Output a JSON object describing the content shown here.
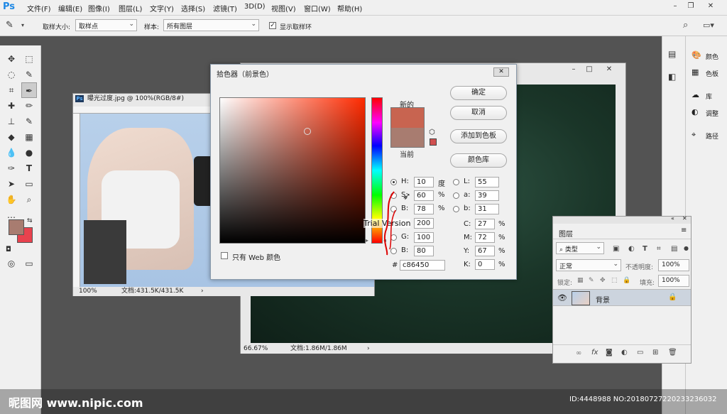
{
  "menubar": {
    "logo": "Ps",
    "items": [
      "文件(F)",
      "编辑(E)",
      "图像(I)",
      "图层(L)",
      "文字(Y)",
      "选择(S)",
      "滤镜(T)",
      "3D(D)",
      "视图(V)",
      "窗口(W)",
      "帮助(H)"
    ],
    "win_min": "–",
    "win_max": "❐",
    "win_close": "✕"
  },
  "options": {
    "sample_size_label": "取样大小:",
    "sample_size_value": "取样点",
    "sample_label": "样本:",
    "sample_value": "所有图层",
    "show_ring_label": "显示取样环"
  },
  "doc1": {
    "title": "曝光过度.jpg @ 100%(RGB/8#)",
    "zoom": "100%",
    "doc_info": "文档:431.5K/431.5K",
    "ps_badge": "Ps"
  },
  "doc2": {
    "zoom": "66.67%",
    "doc_info": "文档:1.86M/1.86M"
  },
  "picker": {
    "title": "拾色器（前景色）",
    "new_label": "新的",
    "current_label": "当前",
    "new_color": "#c86450",
    "current_color": "#a87c70",
    "ok": "确定",
    "cancel": "取消",
    "add_swatch": "添加到色板",
    "color_lib": "颜色库",
    "web_only": "只有 Web 颜色",
    "H": "10",
    "H_unit": "度",
    "S": "60",
    "S_unit": "%",
    "B": "78",
    "B_unit": "%",
    "R": "200",
    "G": "100",
    "Bv": "80",
    "L": "55",
    "a": "39",
    "b": "31",
    "C": "27",
    "M": "72",
    "Y": "67",
    "K": "0",
    "hex": "c86450",
    "pct": "%",
    "lbl_H": "H:",
    "lbl_S": "S:",
    "lbl_B": "B:",
    "lbl_R": "R:",
    "lbl_G": "G:",
    "lbl_Bv": "B:",
    "lbl_L": "L:",
    "lbl_a": "a:",
    "lbl_b": "b:",
    "lbl_C": "C:",
    "lbl_M": "M:",
    "lbl_Y": "Y:",
    "lbl_K": "K:",
    "hash": "#",
    "trial_text": "Trial Version"
  },
  "right_panels": {
    "items": [
      "颜色",
      "色板",
      "库",
      "调整",
      "路径"
    ]
  },
  "layers": {
    "tab": "图层",
    "kind": "类型",
    "blend": "正常",
    "opacity_label": "不透明度:",
    "opacity": "100%",
    "lock_label": "锁定:",
    "fill_label": "填充:",
    "fill": "100%",
    "layer_name": "背景",
    "fx": "fx"
  },
  "watermark": {
    "site": "昵图网 www.nipic.com",
    "id": "ID:4448988 NO:20180727220233236032"
  },
  "colors": {
    "fg": "#a87c70",
    "bg": "#e8424e"
  }
}
